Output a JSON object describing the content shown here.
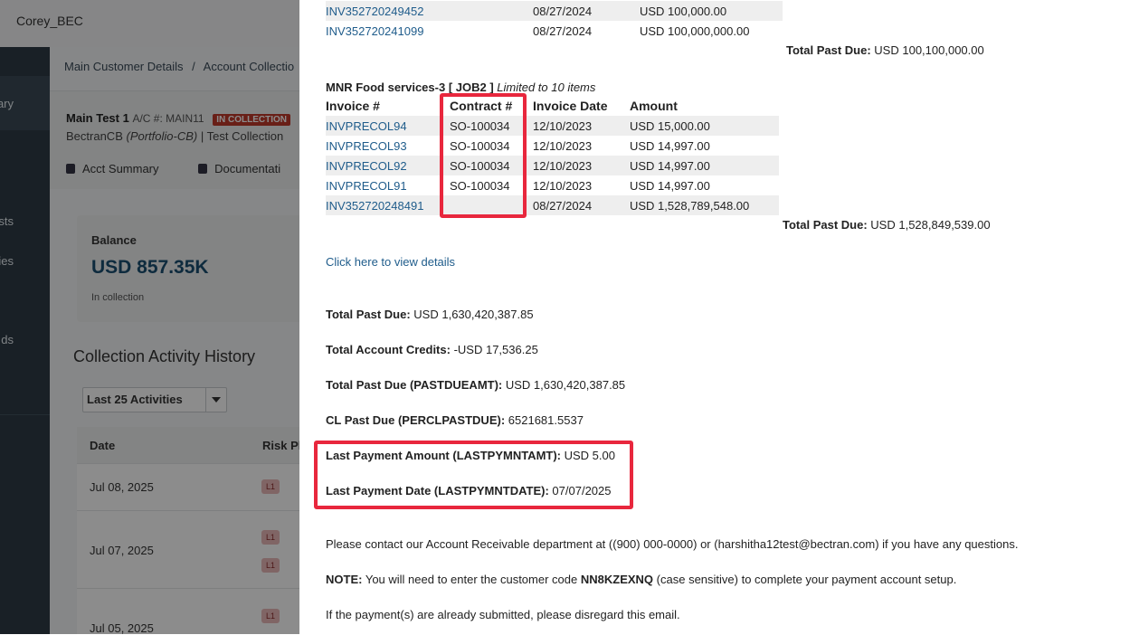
{
  "app": {
    "user": "Corey_BEC",
    "nav_items": [
      "ary",
      "ests",
      "ies",
      "ds"
    ],
    "breadcrumbs": [
      "Main Customer Details",
      "/",
      "Account Collectio"
    ],
    "account": {
      "name": "Main Test 1",
      "ac_label": "A/C #: MAIN11",
      "status_badge": "IN COLLECTION",
      "company": "BectranCB",
      "portfolio": "(Portfolio-CB)",
      "sep": "|",
      "collection": "Test Collection"
    },
    "tabs": [
      "Acct Summary",
      "Documentati"
    ],
    "balance": {
      "label": "Balance",
      "amount": "USD 857.35K",
      "status": "In collection"
    },
    "history": {
      "title": "Collection Activity History",
      "filter": "Last 25 Activities",
      "columns": [
        "Date",
        "Risk Ph"
      ],
      "rows": [
        {
          "date": "Jul 08, 2025",
          "risks": [
            "L1"
          ]
        },
        {
          "date": "Jul 07, 2025",
          "risks": [
            "L1",
            "L1"
          ]
        },
        {
          "date": "Jul 05, 2025",
          "risks": [
            "L1"
          ]
        }
      ]
    }
  },
  "email": {
    "top_invoices": [
      {
        "invoice": "INV352720249452",
        "date": "08/27/2024",
        "amount": "USD 100,000.00"
      },
      {
        "invoice": "INV352720241099",
        "date": "08/27/2024",
        "amount": "USD 100,000,000.00"
      }
    ],
    "top_total_label": "Total Past Due:",
    "top_total_value": "USD 100,100,000.00",
    "section2_title": "MNR Food services-3 [ JOB2 ]",
    "section2_note": "Limited to 10 items",
    "section2_headers": [
      "Invoice #",
      "Contract #",
      "Invoice Date",
      "Amount"
    ],
    "section2_rows": [
      {
        "invoice": "INVPRECOL94",
        "contract": "SO-100034",
        "date": "12/10/2023",
        "amount": "USD 15,000.00"
      },
      {
        "invoice": "INVPRECOL93",
        "contract": "SO-100034",
        "date": "12/10/2023",
        "amount": "USD 14,997.00"
      },
      {
        "invoice": "INVPRECOL92",
        "contract": "SO-100034",
        "date": "12/10/2023",
        "amount": "USD 14,997.00"
      },
      {
        "invoice": "INVPRECOL91",
        "contract": "SO-100034",
        "date": "12/10/2023",
        "amount": "USD 14,997.00"
      },
      {
        "invoice": "INV352720248491",
        "contract": "",
        "date": "08/27/2024",
        "amount": "USD 1,528,789,548.00"
      }
    ],
    "section2_total_label": "Total Past Due:",
    "section2_total_value": "USD 1,528,849,539.00",
    "view_details_link": "Click here to view details",
    "summary": [
      {
        "label": "Total Past Due:",
        "value": "USD 1,630,420,387.85"
      },
      {
        "label": "Total Account Credits:",
        "value": "-USD 17,536.25"
      },
      {
        "label": "Total Past Due (PASTDUEAMT):",
        "value": "USD 1,630,420,387.85"
      },
      {
        "label": "CL Past Due (PERCLPASTDUE):",
        "value": "6521681.5537"
      },
      {
        "label": "Last Payment Amount (LASTPYMNTAMT):",
        "value": "USD 5.00"
      },
      {
        "label": "Last Payment Date (LASTPYMNTDATE):",
        "value": "07/07/2025"
      }
    ],
    "contact_text": "Please contact our Account Receivable department at ((900) 000-0000) or (harshitha12test@bectran.com) if you have any questions.",
    "note_label": "NOTE:",
    "note_pre": "You will need to enter the customer code",
    "note_code": "NN8KZEXNQ",
    "note_post": "(case sensitive) to complete your payment account setup.",
    "disregard_text": "If the payment(s) are already submitted, please disregard this email.",
    "highlight_color": "#e8273d"
  }
}
